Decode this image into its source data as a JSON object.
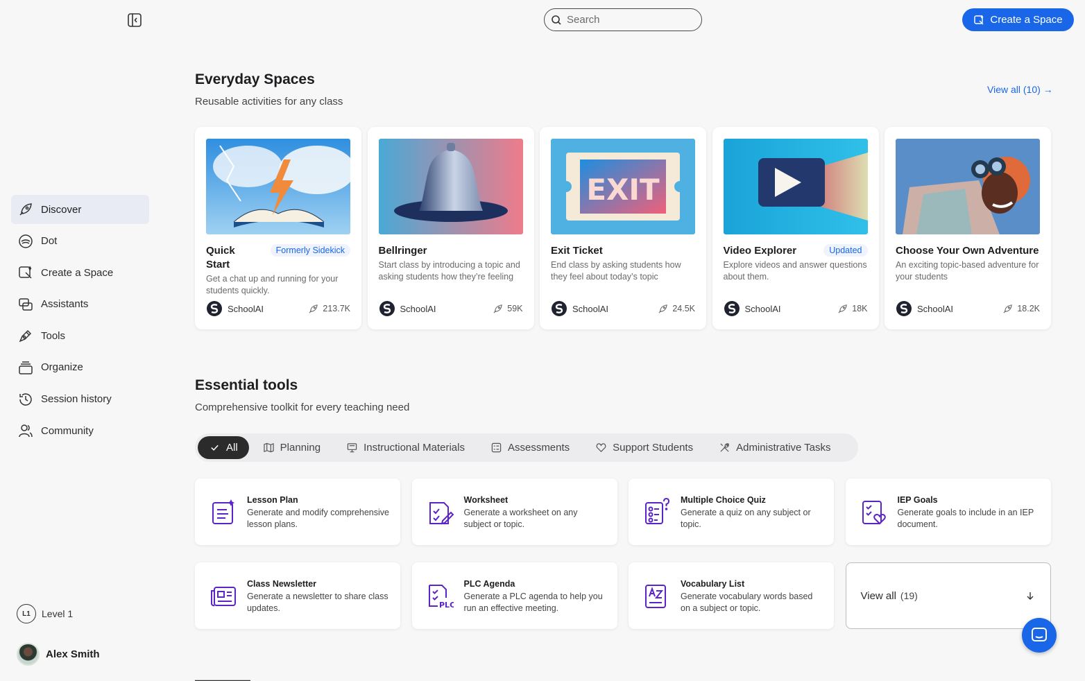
{
  "search": {
    "placeholder": "Search"
  },
  "header": {
    "create_label": "Create a Space"
  },
  "sidebar": {
    "items": [
      {
        "label": "Discover",
        "icon": "rocket-icon",
        "active": true
      },
      {
        "label": "Dot",
        "icon": "dot-chat-icon"
      },
      {
        "label": "Create a Space",
        "icon": "create-space-icon"
      },
      {
        "label": "Assistants",
        "icon": "assistants-icon"
      },
      {
        "label": "Tools",
        "icon": "tools-pen-icon"
      },
      {
        "label": "Organize",
        "icon": "folders-icon"
      },
      {
        "label": "Session history",
        "icon": "history-icon"
      },
      {
        "label": "Community",
        "icon": "community-icon"
      }
    ],
    "level_badge": "L1",
    "level_label": "Level 1",
    "user_name": "Alex Smith"
  },
  "everyday": {
    "title": "Everyday Spaces",
    "subtitle": "Reusable activities for any class",
    "view_all": "View all (10) →",
    "cards": [
      {
        "title": "Quick Start",
        "tag": "Formerly Sidekick",
        "desc": "Get a chat up and running for your students quickly.",
        "author": "SchoolAI",
        "uses": "213.7K",
        "image": "lightning-book"
      },
      {
        "title": "Bellringer",
        "tag": "",
        "desc": "Start class by introducing a topic and asking students how they’re feeling",
        "author": "SchoolAI",
        "uses": "59K",
        "image": "bell"
      },
      {
        "title": "Exit Ticket",
        "tag": "",
        "desc": "End class by asking students how they feel about today’s topic",
        "author": "SchoolAI",
        "uses": "24.5K",
        "image": "exit-ticket"
      },
      {
        "title": "Video Explorer",
        "tag": "Updated",
        "desc": "Explore videos and answer questions about them.",
        "author": "SchoolAI",
        "uses": "18K",
        "image": "play-button"
      },
      {
        "title": "Choose Your Own Adventure",
        "tag": "",
        "desc": "An exciting topic-based adventure for your students",
        "author": "SchoolAI",
        "uses": "18.2K",
        "image": "binoculars"
      }
    ]
  },
  "essential": {
    "title": "Essential tools",
    "subtitle": "Comprehensive toolkit for every teaching need",
    "filters": [
      {
        "label": "All",
        "icon": "check-icon",
        "active": true
      },
      {
        "label": "Planning",
        "icon": "map-icon"
      },
      {
        "label": "Instructional Materials",
        "icon": "presentation-icon"
      },
      {
        "label": "Assessments",
        "icon": "checklist-icon"
      },
      {
        "label": "Support Students",
        "icon": "heart-icon"
      },
      {
        "label": "Administrative Tasks",
        "icon": "tools-icon"
      }
    ],
    "tools": [
      {
        "title": "Lesson Plan",
        "desc": "Generate and modify comprehensive lesson plans.",
        "icon": "lesson-plan-icon"
      },
      {
        "title": "Worksheet",
        "desc": "Generate a worksheet on any subject or topic.",
        "icon": "worksheet-icon"
      },
      {
        "title": "Multiple Choice Quiz",
        "desc": "Generate a quiz on any subject or topic.",
        "icon": "quiz-icon"
      },
      {
        "title": "IEP Goals",
        "desc": "Generate goals to include in an IEP document.",
        "icon": "iep-goals-icon"
      },
      {
        "title": "Class Newsletter",
        "desc": "Generate a newsletter to share class updates.",
        "icon": "newsletter-icon"
      },
      {
        "title": "PLC Agenda",
        "desc": "Generate a PLC agenda to help you run an effective meeting.",
        "icon": "plc-agenda-icon"
      },
      {
        "title": "Vocabulary List",
        "desc": "Generate vocabulary words based on a subject or topic.",
        "icon": "vocabulary-icon"
      }
    ],
    "view_all_label": "View all",
    "view_all_count": "(19)"
  },
  "colors": {
    "accent": "#1967e8",
    "tool_icon": "#5b23c9",
    "active_nav_bg": "#e9ebf4"
  }
}
